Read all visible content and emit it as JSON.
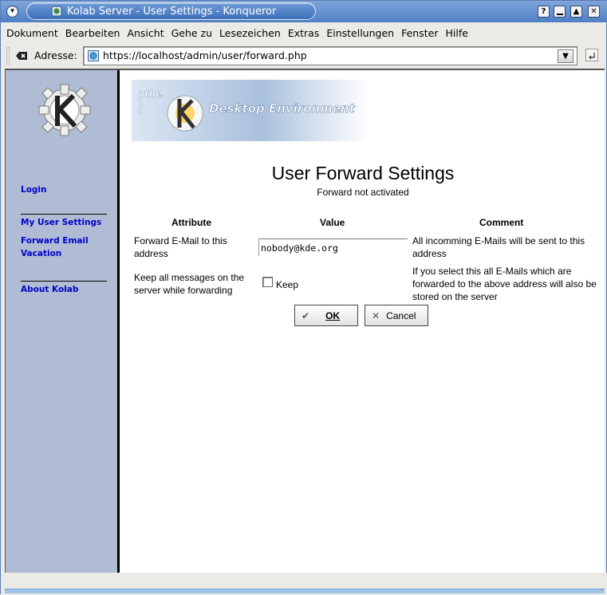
{
  "window": {
    "title": "Kolab Server - User Settings - Konqueror",
    "buttons": {
      "help": "?",
      "minimize": "_",
      "maximize": "▲",
      "close": "✕"
    }
  },
  "menubar": {
    "items": [
      {
        "label": "Dokument"
      },
      {
        "label": "Bearbeiten"
      },
      {
        "label": "Ansicht"
      },
      {
        "label": "Gehe zu"
      },
      {
        "label": "Lesezeichen"
      },
      {
        "label": "Extras"
      },
      {
        "label": "Einstellungen"
      },
      {
        "label": "Fenster"
      },
      {
        "label": "Hilfe"
      }
    ]
  },
  "location": {
    "label": "Adresse:",
    "url": "https://localhost/admin/user/forward.php"
  },
  "sidebar": {
    "login": "Login",
    "my_user_settings": "My User Settings",
    "forward_email": "Forward Email",
    "vacation": "Vacation",
    "about": "About Kolab"
  },
  "banner": {
    "the": "the",
    "alpha": "Alpha",
    "desktop": "Desktop Environment"
  },
  "page": {
    "title": "User Forward Settings",
    "subtitle": "Forward not activated"
  },
  "table": {
    "headers": {
      "attribute": "Attribute",
      "value": "Value",
      "comment": "Comment"
    },
    "rows": [
      {
        "attribute": "Forward E-Mail to this address",
        "value": "nobody@kde.org",
        "comment": "All incomming E-Mails will be sent to this address"
      },
      {
        "attribute": "Keep all messages on the server while forwarding",
        "value": "Keep",
        "checked": false,
        "comment": "If you select this all E-Mails which are forwarded to the above address will also be stored on the server"
      }
    ]
  },
  "buttons": {
    "ok": "OK",
    "cancel": "Cancel"
  },
  "colors": {
    "sidebar_bg": "#b0bcd4",
    "link": "#0000c8",
    "titlebar": "#4f7fc4"
  }
}
